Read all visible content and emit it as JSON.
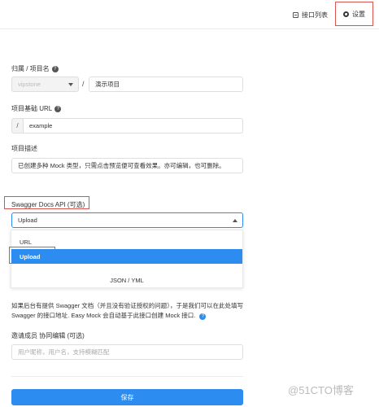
{
  "nav": {
    "api_list": "接口列表",
    "settings": "设置"
  },
  "form": {
    "owner_label": "归属 / 项目名",
    "owner_value": "vipstone",
    "project_name": "演示项目",
    "base_url_label": "项目基础 URL",
    "base_url_prefix": "/",
    "base_url_value": "example",
    "desc_label": "项目描述",
    "desc_value": "已创建多种 Mock 类型，只需点击预览便可查看效果。亦可编辑，也可删除。",
    "swagger_label": "Swagger Docs API (可选)",
    "swagger_selected": "Upload",
    "swagger_options": [
      "URL",
      "Upload",
      "JSON / YML"
    ],
    "help_text": "如果后台有提供 Swagger 文档（并且没有验证授权的问题），于是我们可以在此处填写 Swagger 的接口地址. Easy Mock 会自动基于此接口创建 Mock 接口.",
    "members_label": "邀请成员 协同编辑 (可选)",
    "members_placeholder": "用户昵称，用户名，支持模糊匹配",
    "save_label": "保存"
  },
  "watermark": "@51CTO博客",
  "colors": {
    "primary": "#2d8cf0",
    "highlight_border": "#d9534f"
  }
}
